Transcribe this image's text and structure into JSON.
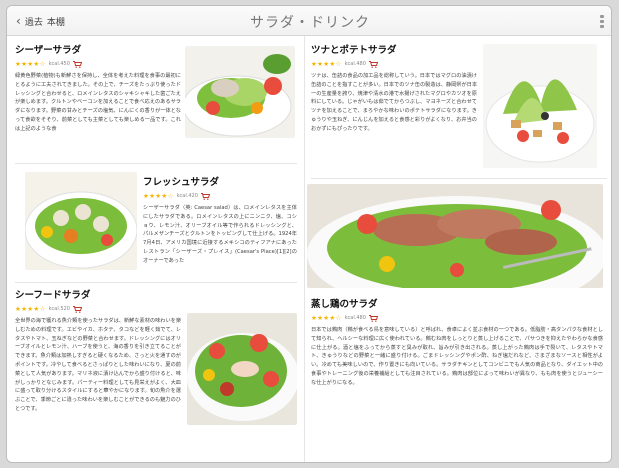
{
  "header": {
    "back_label": "過去",
    "back_label_suffix": "本棚",
    "title": "サラダ・ドリンク"
  },
  "recipes": [
    {
      "name": "シーザーサラダ",
      "stars": "★★★★☆",
      "kcal": "kcal.450",
      "text": "緑黄色野菜(植物)も新鮮さを保持し、全体を考えた料理を食事の最初にとるように工夫されてきました。その上で、チーズをたっぷり使ったドレッシングと合わせると、ロメインレタスのシャキシャキした歯ごたえが楽しめます。クルトンやベーコンを加えることで食べ応えのあるサラダになります。野菜の甘みとチーズの塩気、にんにくの香りが一体となって食欲をそそり、前菜としても主菜としても楽しめる一品です。これは上記のような食"
    },
    {
      "name": "フレッシュサラダ",
      "stars": "★★★★☆",
      "kcal": "kcal.420",
      "text": "シーザーサラダ（英: Caesar salad）は、ロメインレタスを主体にしたサラダである。ロメインレタスの上にニンニク、塩、コショウ、レモン汁、オリーブオイル等で作られるドレッシングと、パルメザンチーズとクルトンをトッピングして仕上げる。1924年7月4日、アメリカ国境に近接するメキシコのティフアナにあったレストラン「シーザーズ・プレイス」(Caesar's Place)[1][2]のオーナーであった"
    },
    {
      "name": "シーフードサラダ",
      "stars": "★★★★☆",
      "kcal": "kcal.520",
      "text": "全世界の海で獲れる魚介類を使ったサラダは、新鮮な素材の味わいを楽しむための料理です。エビやイカ、ホタテ、タコなどを軽く茹でて、レタスやトマト、玉ねぎなどの野菜と合わせます。ドレッシングにはオリーブオイルとレモン汁、ハーブを使うと、海の香りを引き立てることができます。魚介類は加熱しすぎると硬くなるため、さっと火を通すのがポイントです。冷やして食べるとさっぱりとした味わいになり、夏の前菜として人気があります。マリネ液に漬け込んでから盛り付けると、味がしっかりとなじみます。パーティー料理としても見栄えがよく、大皿に盛って取り分けるスタイルにすると華やかになります。旬の魚介を選ぶことで、季節ごとに違った味わいを楽しむことができるのも魅力のひとつです。"
    },
    {
      "name": "ツナとポテトサラダ",
      "stars": "★★★★☆",
      "kcal": "kcal.480",
      "text": "ツナは、缶詰の食品の加工品を総称していう。日本ではマグロの油漬け缶詰のことを指すことが多い。日本でのツナ缶の製造は、静岡県が日本一の生産量を誇り、焼津や清水の港で水揚げされたマグロやカツオを原料にしている。じゃがいもは茹でてからつぶし、マヨネーズと合わせてツナを加えることで、まろやかな味わいのポテトサラダになります。きゅうりや玉ねぎ、にんじんを加えると食感と彩りがよくなり、お弁当のおかずにもぴったりです。"
    },
    {
      "name": "蒸し鶏のサラダ",
      "stars": "★★★★☆",
      "kcal": "kcal.480",
      "text": "日本では鶏肉（鶏が食べる鳥を意味している）と呼ばれ、食卓によく並ぶ食材の一つである。低脂肪・高タンパクな食材として知られ、ヘルシーな料理に広く使われている。鶏むね肉をしっとりと蒸し上げることで、パサつきを抑えたやわらかな食感に仕上がる。酒と塩をふってから蒸すと臭みが取れ、旨みが引き出される。蒸し上がった鶏肉は手で裂いて、レタスやトマト、きゅうりなどの野菜と一緒に盛り付ける。ごまドレッシングやポン酢、ねぎ塩だれなど、さまざまなソースと相性がよい。冷めても美味しいので、作り置きにも向いている。サラダチキンとしてコンビニでも人気の商品となり、ダイエット中の食事やトレーニング後の栄養補給としても注目されている。鶏肉は部位によって味わいが異なり、もも肉を使うとジューシーな仕上がりになる。"
    }
  ],
  "colors": {
    "accent_stars": "#f2b400",
    "cart": "#c0392b"
  }
}
